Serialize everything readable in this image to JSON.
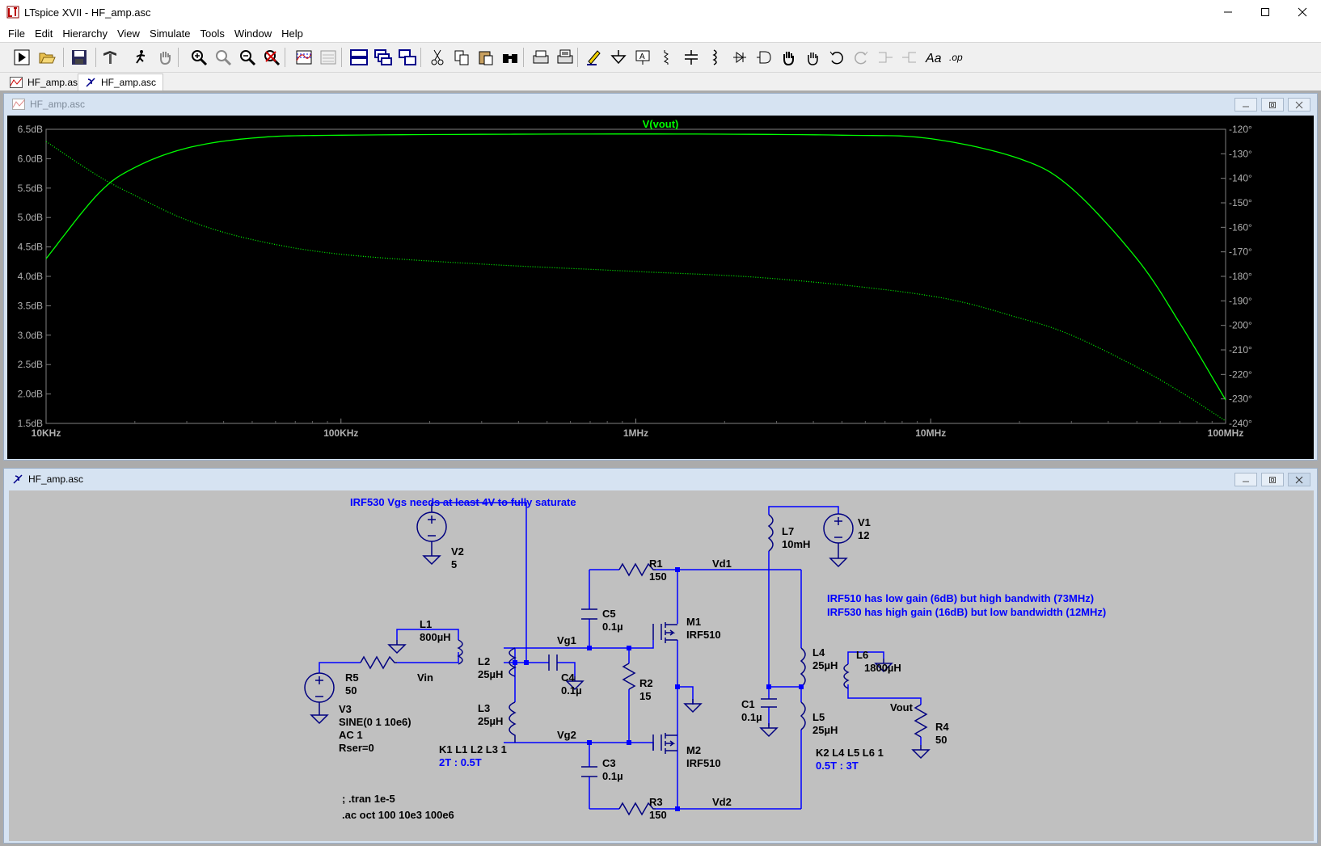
{
  "window": {
    "title": "LTspice XVII - HF_amp.asc"
  },
  "menu": [
    "File",
    "Edit",
    "Hierarchy",
    "View",
    "Simulate",
    "Tools",
    "Window",
    "Help"
  ],
  "toolbar": [
    "run-icon",
    "open-icon",
    "save-icon",
    "control-panel-icon",
    "halt-icon",
    "pan-icon",
    "zoom-in-icon",
    "zoom-fit-icon",
    "zoom-out-icon",
    "zoom-cancel-icon",
    "autoscale-icon",
    "plot-settings-icon",
    "tile-horizontal-icon",
    "cascade-icon",
    "tile-vertical-icon",
    "cut-icon",
    "copy-icon",
    "paste-icon",
    "find-icon",
    "print-icon",
    "print-preview-icon",
    "draw-wire-icon",
    "ground-icon",
    "label-net-icon",
    "resistor-icon",
    "capacitor-icon",
    "inductor-icon",
    "diode-icon",
    "component-icon",
    "move-icon",
    "drag-icon",
    "undo-icon",
    "redo-icon",
    "rotate-icon",
    "mirror-icon",
    "text-icon",
    "spice-directive-icon"
  ],
  "tabs": [
    {
      "label": "HF_amp.asc",
      "icon": "waveform-icon",
      "active": false
    },
    {
      "label": "HF_amp.asc",
      "icon": "schematic-icon",
      "active": true
    }
  ],
  "plot_window": {
    "title": "HF_amp.asc"
  },
  "schematic_window": {
    "title": "HF_amp.asc"
  },
  "chart_data": {
    "type": "line",
    "title": "V(vout)",
    "x_scale": "log",
    "x_ticks": [
      "10KHz",
      "100KHz",
      "1MHz",
      "10MHz",
      "100MHz"
    ],
    "x_range_hz": [
      10000,
      100000000
    ],
    "y_left_ticks": [
      "6.5dB",
      "6.0dB",
      "5.5dB",
      "5.0dB",
      "4.5dB",
      "4.0dB",
      "3.5dB",
      "3.0dB",
      "2.5dB",
      "2.0dB",
      "1.5dB"
    ],
    "y_left_range_db": [
      1.5,
      6.5
    ],
    "y_right_ticks": [
      "-120°",
      "-130°",
      "-140°",
      "-150°",
      "-160°",
      "-170°",
      "-180°",
      "-190°",
      "-200°",
      "-210°",
      "-220°",
      "-230°",
      "-240°"
    ],
    "y_right_range_deg": [
      -240,
      -120
    ],
    "series": [
      {
        "role": "magnitude",
        "color": "#00ff00",
        "style": "solid",
        "x": [
          10000,
          15000,
          20000,
          30000,
          50000,
          100000,
          1000000,
          5000000,
          10000000,
          20000000,
          30000000,
          50000000,
          70000000,
          100000000
        ],
        "y": [
          4.3,
          5.4,
          5.85,
          6.18,
          6.35,
          6.4,
          6.42,
          6.4,
          6.34,
          6.0,
          5.5,
          4.3,
          3.2,
          1.9
        ]
      },
      {
        "role": "phase",
        "color": "#00ff00",
        "style": "dotted",
        "x": [
          10000,
          15000,
          20000,
          30000,
          50000,
          100000,
          300000,
          1000000,
          3000000,
          10000000,
          20000000,
          30000000,
          50000000,
          70000000,
          100000000
        ],
        "y": [
          -125,
          -139,
          -147,
          -157,
          -165,
          -171,
          -175,
          -178,
          -181,
          -188,
          -197,
          -204,
          -217,
          -227,
          -239
        ]
      }
    ]
  },
  "schematic": {
    "comment_top": "IRF530 Vgs needs at least 4V to fully saturate",
    "comment_bw1": "IRF510 has low gain (6dB) but high bandwith (73MHz)",
    "comment_bw2": "IRF530 has high gain (16dB) but low bandwidth (12MHz)",
    "V1": {
      "name": "V1",
      "value": "12"
    },
    "V2": {
      "name": "V2",
      "value": "5"
    },
    "V3": {
      "name": "V3",
      "value": "SINE(0 1 10e6)",
      "ac": "AC 1",
      "rser": "Rser=0"
    },
    "R1": {
      "name": "R1",
      "value": "150"
    },
    "R2": {
      "name": "R2",
      "value": "15"
    },
    "R3": {
      "name": "R3",
      "value": "150"
    },
    "R4": {
      "name": "R4",
      "value": "50"
    },
    "R5": {
      "name": "R5",
      "value": "50"
    },
    "C1": {
      "name": "C1",
      "value": "0.1µ"
    },
    "C3": {
      "name": "C3",
      "value": "0.1µ"
    },
    "C4": {
      "name": "C4",
      "value": "0.1µ"
    },
    "C5": {
      "name": "C5",
      "value": "0.1µ"
    },
    "L1": {
      "name": "L1",
      "value": "800µH"
    },
    "L2": {
      "name": "L2",
      "value": "25µH"
    },
    "L3": {
      "name": "L3",
      "value": "25µH"
    },
    "L4": {
      "name": "L4",
      "value": "25µH"
    },
    "L5": {
      "name": "L5",
      "value": "25µH"
    },
    "L6": {
      "name": "L6",
      "value": "1800µH"
    },
    "L7": {
      "name": "L7",
      "value": "10mH"
    },
    "M1": {
      "name": "M1",
      "value": "IRF510"
    },
    "M2": {
      "name": "M2",
      "value": "IRF510"
    },
    "nets": {
      "vd1": "Vd1",
      "vd2": "Vd2",
      "vg1": "Vg1",
      "vg2": "Vg2",
      "vin": "Vin",
      "vout": "Vout"
    },
    "k1": "K1 L1 L2 L3 1",
    "k1_ratio": "2T : 0.5T",
    "k2": "K2 L4 L5 L6 1",
    "k2_ratio": "0.5T : 3T",
    "tran": "; .tran 1e-5",
    "ac": ".ac oct 100 10e3 100e6"
  },
  "colors": {
    "wire": "#0000ff",
    "component": "#000080",
    "comment": "#0000ff",
    "trace": "#00ff00",
    "plot_bg": "#000000",
    "schematic_bg": "#c0c0c0"
  }
}
